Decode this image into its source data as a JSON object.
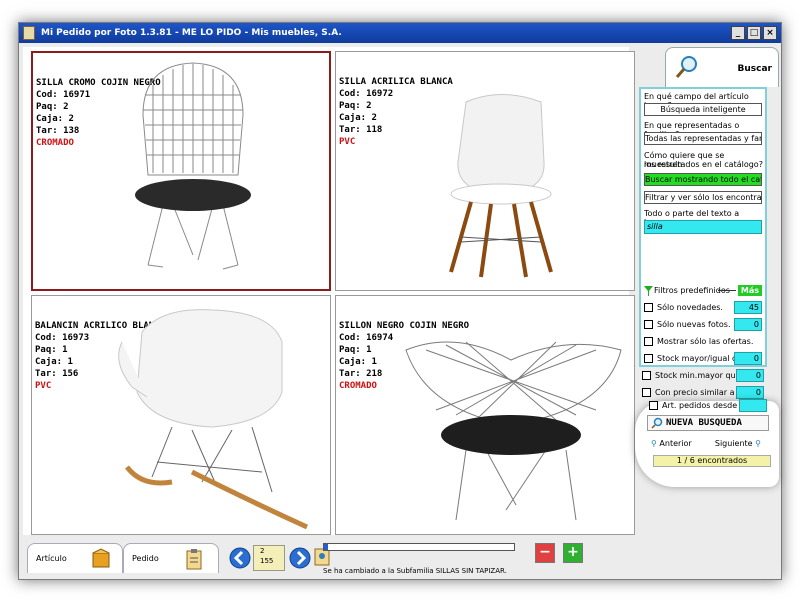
{
  "window": {
    "title": "Mi Pedido por Foto 1.3.81   - ME LO PIDO -  Mis muebles, S.A.",
    "controls": {
      "minimize": "_",
      "maximize": "□",
      "close": "×"
    }
  },
  "products": [
    {
      "name": "SILLA CROMO COJIN NEGRO",
      "cod": "Cod: 16971",
      "paq": "Paq: 2",
      "caja": "Caja: 2",
      "tar": "Tar: 138",
      "finish": "CROMADO"
    },
    {
      "name": "SILLA ACRILICA BLANCA",
      "cod": "Cod: 16972",
      "paq": "Paq: 2",
      "caja": "Caja: 2",
      "tar": "Tar: 118",
      "finish": "PVC"
    },
    {
      "name": "BALANCIN ACRILICO BLANCO",
      "cod": "Cod: 16973",
      "paq": "Paq: 1",
      "caja": "Caja: 1",
      "tar": "Tar: 156",
      "finish": "PVC"
    },
    {
      "name": "SILLON NEGRO COJIN NEGRO",
      "cod": "Cod: 16974",
      "paq": "Paq: 1",
      "caja": "Caja: 1",
      "tar": "Tar: 218",
      "finish": "CROMADO"
    }
  ],
  "search": {
    "tab_label": "Buscar",
    "q1": "En qué campo del artículo busco?",
    "field_option": "Búsqueda inteligente",
    "q2": "En que representadas o familias?",
    "family_option": "Todas las representadas y familias",
    "q3_line1": "Cómo quiere que se muestren",
    "q3_line2": "los resultados en el catálogo?",
    "show_all": "Buscar mostrando todo el catálogo",
    "filter_found": "Filtrar y ver sólo los encontrados",
    "q4": "Todo o parte del texto a buscar:",
    "text_value": "silla",
    "filters_label": "Filtros predefinidos",
    "more_label": "Más",
    "filters": [
      {
        "label": "Sólo novedades.",
        "value": "45"
      },
      {
        "label": "Sólo nuevas fotos.",
        "value": "0"
      },
      {
        "label": "Mostrar sólo las ofertas.",
        "value": ""
      },
      {
        "label": "Stock mayor/igual que",
        "value": "0"
      },
      {
        "label": "Stock min.mayor que",
        "value": "0"
      },
      {
        "label": "Con precio similar a",
        "value": "0"
      },
      {
        "label": "Art. pedidos desde",
        "value": ""
      }
    ],
    "new_search": "NUEVA BUSQUEDA",
    "prev": "Anterior",
    "next": "Siguiente",
    "found": "1 / 6 encontrados"
  },
  "bottom": {
    "tab_article": "Artículo",
    "tab_order": "Pedido",
    "pager_line1": "2",
    "pager_line2": "155",
    "status": "Se ha cambiado a la Subfamilia SILLAS SIN TAPIZAR.",
    "minus": "−",
    "plus": "+",
    "progress": 0.02
  },
  "colors": {
    "accent": "#22dd22",
    "field": "#33e8ee",
    "finish": "#d01010",
    "selected": "#8c1c1c"
  }
}
